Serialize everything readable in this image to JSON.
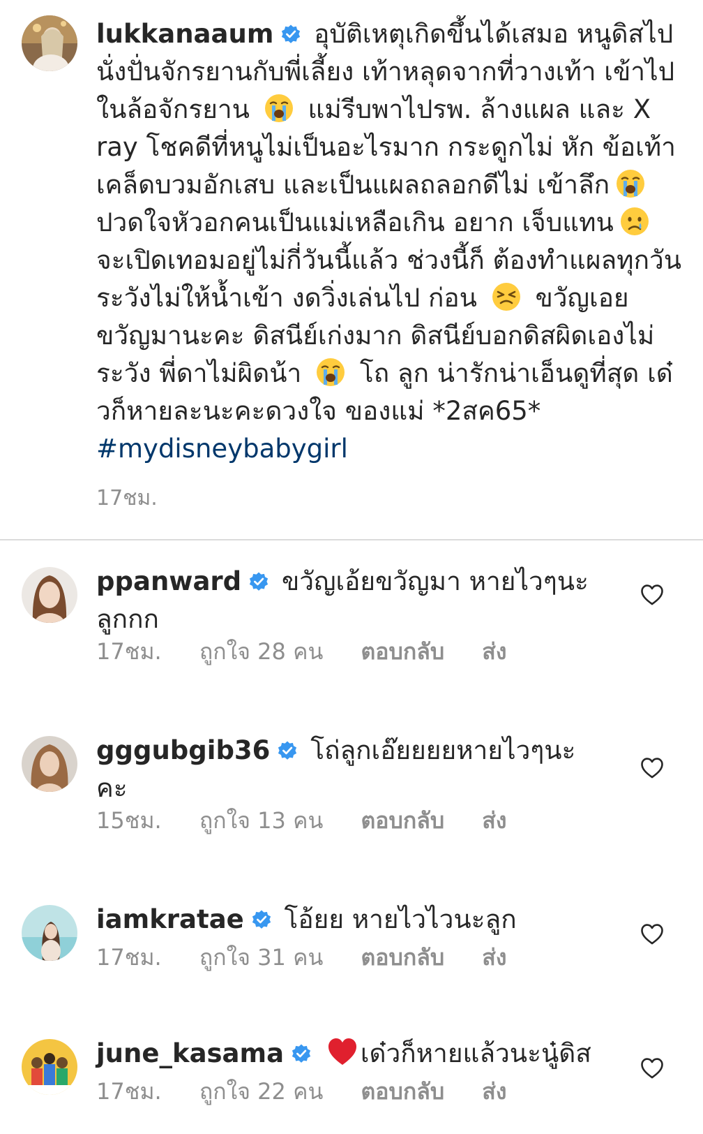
{
  "caption": {
    "username": "lukkanaaum",
    "text_part1": "อุบัติเหตุเกิดขึ้นได้เสมอ หนูดิสไป นั่งปั่นจักรยานกับพี่เลี้ยง เท้าหลุดจากที่วางเท้า เข้าไปในล้อจักรยาน",
    "text_part2": "แม่รีบพาไปรพ. ล้างแผล และ X ray โชคดีที่หนูไม่เป็นอะไรมาก กระดูกไม่ หัก ข้อเท้าเคล็ดบวมอักเสบ และเป็นแผลถลอกดีไม่ เข้าลึก",
    "text_part3": "ปวดใจหัวอกคนเป็นแม่เหลือเกิน อยาก เจ็บแทน",
    "text_part4": "จะเปิดเทอมอยู่ไม่กี่วันนี้แล้ว ช่วงนี้ก็ ต้องทำแผลทุกวัน ระวังไม่ให้น้ำเข้า งดวิ่งเล่นไป ก่อน",
    "text_part5": "ขวัญเอยขวัญมานะคะ ดิสนีย์เก่งมาก ดิสนีย์บอกดิสผิดเองไม่ระวัง พี่ดาไม่ผิดน้า",
    "text_part6": "โถ ลูก น่ารักน่าเอ็นดูที่สุด เด๋วก็หายละนะคะดวงใจ ของแม่ *2สค65*",
    "hashtag": "#mydisneybabygirl",
    "time": "17ชม."
  },
  "comments": [
    {
      "username": "ppanward",
      "text": "ขวัญเอ้ยขวัญมา หายไวๆนะ ลูกกก",
      "time": "17ชม.",
      "likes": "ถูกใจ 28 คน",
      "reply": "ตอบกลับ",
      "send": "ส่ง"
    },
    {
      "username": "gggubgib36",
      "text": "โถ่ลูกเอ๊ยยยยหายไวๆนะ คะ",
      "time": "15ชม.",
      "likes": "ถูกใจ 13 คน",
      "reply": "ตอบกลับ",
      "send": "ส่ง"
    },
    {
      "username": "iamkratae",
      "text": "โอ้ยย หายไวไวนะลูก",
      "time": "17ชม.",
      "likes": "ถูกใจ 31 คน",
      "reply": "ตอบกลับ",
      "send": "ส่ง"
    },
    {
      "username": "june_kasama",
      "text": "เด๋วก็หายแล้วนะนู๋ดิส",
      "time": "17ชม.",
      "likes": "ถูกใจ 22 คน",
      "reply": "ตอบกลับ",
      "send": "ส่ง"
    }
  ],
  "icons": {
    "verified": "verified-badge-icon",
    "crying_emoji": "loudly-crying-face",
    "sad_emoji": "crying-face",
    "persevere_emoji": "persevering-face",
    "heart_emoji": "red-heart",
    "like": "heart-outline-icon"
  },
  "colors": {
    "text": "#262626",
    "muted": "#8e8e8e",
    "hashtag": "#00376b",
    "verified": "#3897f0",
    "divider": "#dbdbdb"
  }
}
